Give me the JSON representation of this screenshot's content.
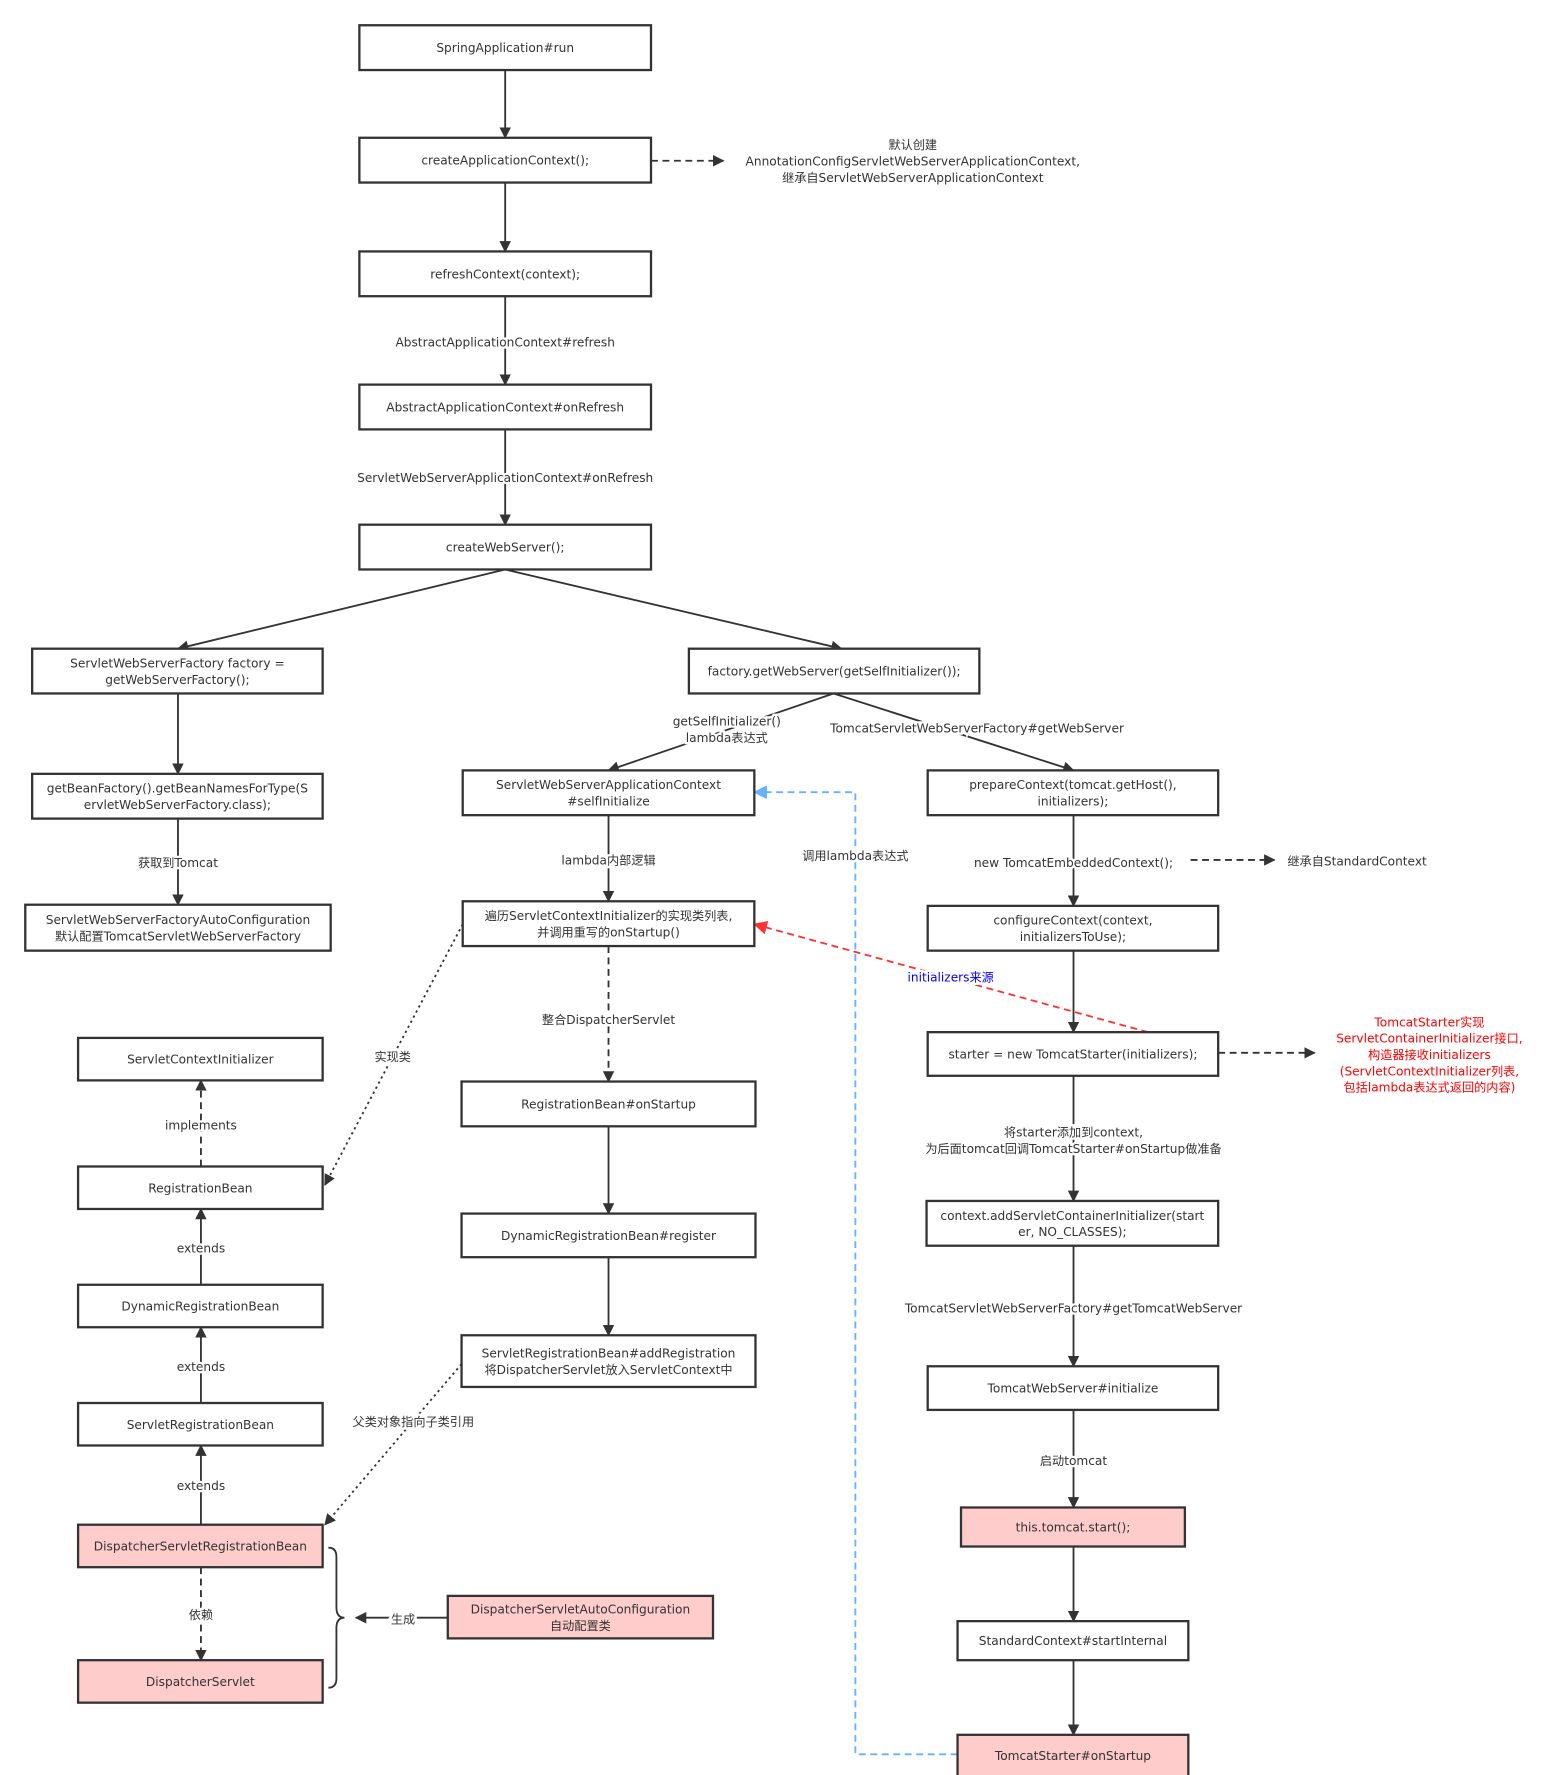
{
  "colors": {
    "stroke": "#333333",
    "highlight_fill": "#ffcccc",
    "normal_fill": "#ffffff",
    "red_note": "#ff0000",
    "blue_label": "#0000ff",
    "blue_edge": "#66b2ff",
    "red_edge": "#ff3333"
  },
  "nodes": [
    {
      "lines": [
        "SpringApplication#run"
      ],
      "highlighted": false
    },
    {
      "lines": [
        "createApplicationContext();"
      ],
      "highlighted": false
    },
    {
      "lines": [
        "refreshContext(context);"
      ],
      "highlighted": false
    },
    {
      "lines": [
        "AbstractApplicationContext#onRefresh"
      ],
      "highlighted": false
    },
    {
      "lines": [
        "createWebServer();"
      ],
      "highlighted": false
    },
    {
      "lines": [
        "ServletWebServerFactory factory =",
        "getWebServerFactory();"
      ],
      "highlighted": false
    },
    {
      "lines": [
        "factory.getWebServer(getSelfInitializer());"
      ],
      "highlighted": false
    },
    {
      "lines": [
        "getBeanFactory().getBeanNamesForType(S",
        "ervletWebServerFactory.class);"
      ],
      "highlighted": false
    },
    {
      "lines": [
        "ServletWebServerFactoryAutoConfiguration",
        "默认配置TomcatServletWebServerFactory"
      ],
      "highlighted": false
    },
    {
      "lines": [
        "ServletWebServerApplicationContext",
        "#selfInitialize"
      ],
      "highlighted": false
    },
    {
      "lines": [
        "遍历ServletContextInitializer的实现类列表,",
        "并调用重写的onStartup()"
      ],
      "highlighted": false
    },
    {
      "lines": [
        "RegistrationBean#onStartup"
      ],
      "highlighted": false
    },
    {
      "lines": [
        "DynamicRegistrationBean#register"
      ],
      "highlighted": false
    },
    {
      "lines": [
        "ServletRegistrationBean#addRegistration",
        "将DispatcherServlet放入ServletContext中"
      ],
      "highlighted": false
    },
    {
      "lines": [
        "ServletContextInitializer"
      ],
      "highlighted": false
    },
    {
      "lines": [
        "RegistrationBean"
      ],
      "highlighted": false
    },
    {
      "lines": [
        "DynamicRegistrationBean"
      ],
      "highlighted": false
    },
    {
      "lines": [
        "ServletRegistrationBean"
      ],
      "highlighted": false
    },
    {
      "lines": [
        "DispatcherServletRegistrationBean"
      ],
      "highlighted": true
    },
    {
      "lines": [
        "DispatcherServlet"
      ],
      "highlighted": true
    },
    {
      "lines": [
        "DispatcherServletAutoConfiguration",
        "自动配置类"
      ],
      "highlighted": true
    },
    {
      "lines": [
        "prepareContext(tomcat.getHost(),",
        "initializers);"
      ],
      "highlighted": false
    },
    {
      "lines": [
        "configureContext(context,",
        "initializersToUse);"
      ],
      "highlighted": false
    },
    {
      "lines": [
        "starter = new TomcatStarter(initializers);"
      ],
      "highlighted": false
    },
    {
      "lines": [
        "context.addServletContainerInitializer(start",
        "er, NO_CLASSES);"
      ],
      "highlighted": false
    },
    {
      "lines": [
        "TomcatWebServer#initialize"
      ],
      "highlighted": false
    },
    {
      "lines": [
        "this.tomcat.start();"
      ],
      "highlighted": true
    },
    {
      "lines": [
        "StandardContext#startInternal"
      ],
      "highlighted": false
    },
    {
      "lines": [
        "TomcatStarter#onStartup"
      ],
      "highlighted": true
    }
  ],
  "labels": [
    {
      "lines": [
        "默认创建",
        "AnnotationConfigServletWebServerApplicationContext,",
        "继承自ServletWebServerApplicationContext"
      ],
      "color": "normal"
    },
    {
      "lines": [
        "AbstractApplicationContext#refresh"
      ],
      "color": "normal"
    },
    {
      "lines": [
        "ServletWebServerApplicationContext#onRefresh"
      ],
      "color": "normal"
    },
    {
      "lines": [
        "getSelfInitializer()",
        "lambda表达式"
      ],
      "color": "normal"
    },
    {
      "lines": [
        "TomcatServletWebServerFactory#getWebServer"
      ],
      "color": "normal"
    },
    {
      "lines": [
        "获取到Tomcat"
      ],
      "color": "normal"
    },
    {
      "lines": [
        "lambda内部逻辑"
      ],
      "color": "normal"
    },
    {
      "lines": [
        "调用lambda表达式"
      ],
      "color": "normal"
    },
    {
      "lines": [
        "new TomcatEmbeddedContext();"
      ],
      "color": "normal"
    },
    {
      "lines": [
        "继承自StandardContext"
      ],
      "color": "normal"
    },
    {
      "lines": [
        "initializers来源"
      ],
      "color": "blue"
    },
    {
      "lines": [
        "整合DispatcherServlet"
      ],
      "color": "normal"
    },
    {
      "lines": [
        "实现类"
      ],
      "color": "normal"
    },
    {
      "lines": [
        "TomcatStarter实现",
        "ServletContainerInitializer接口,",
        "构造器接收initializers",
        "(ServletContextInitializer列表,",
        "包括lambda表达式返回的内容)"
      ],
      "color": "red"
    },
    {
      "lines": [
        "将starter添加到context,",
        "为后面tomcat回调TomcatStarter#onStartup做准备"
      ],
      "color": "normal"
    },
    {
      "lines": [
        "implements"
      ],
      "color": "normal"
    },
    {
      "lines": [
        "extends"
      ],
      "color": "normal"
    },
    {
      "lines": [
        "extends"
      ],
      "color": "normal"
    },
    {
      "lines": [
        "extends"
      ],
      "color": "normal"
    },
    {
      "lines": [
        "父类对象指向子类引用"
      ],
      "color": "normal"
    },
    {
      "lines": [
        "TomcatServletWebServerFactory#getTomcatWebServer"
      ],
      "color": "normal"
    },
    {
      "lines": [
        "启动tomcat"
      ],
      "color": "normal"
    },
    {
      "lines": [
        "依赖"
      ],
      "color": "normal"
    },
    {
      "lines": [
        "生成"
      ],
      "color": "normal"
    }
  ]
}
